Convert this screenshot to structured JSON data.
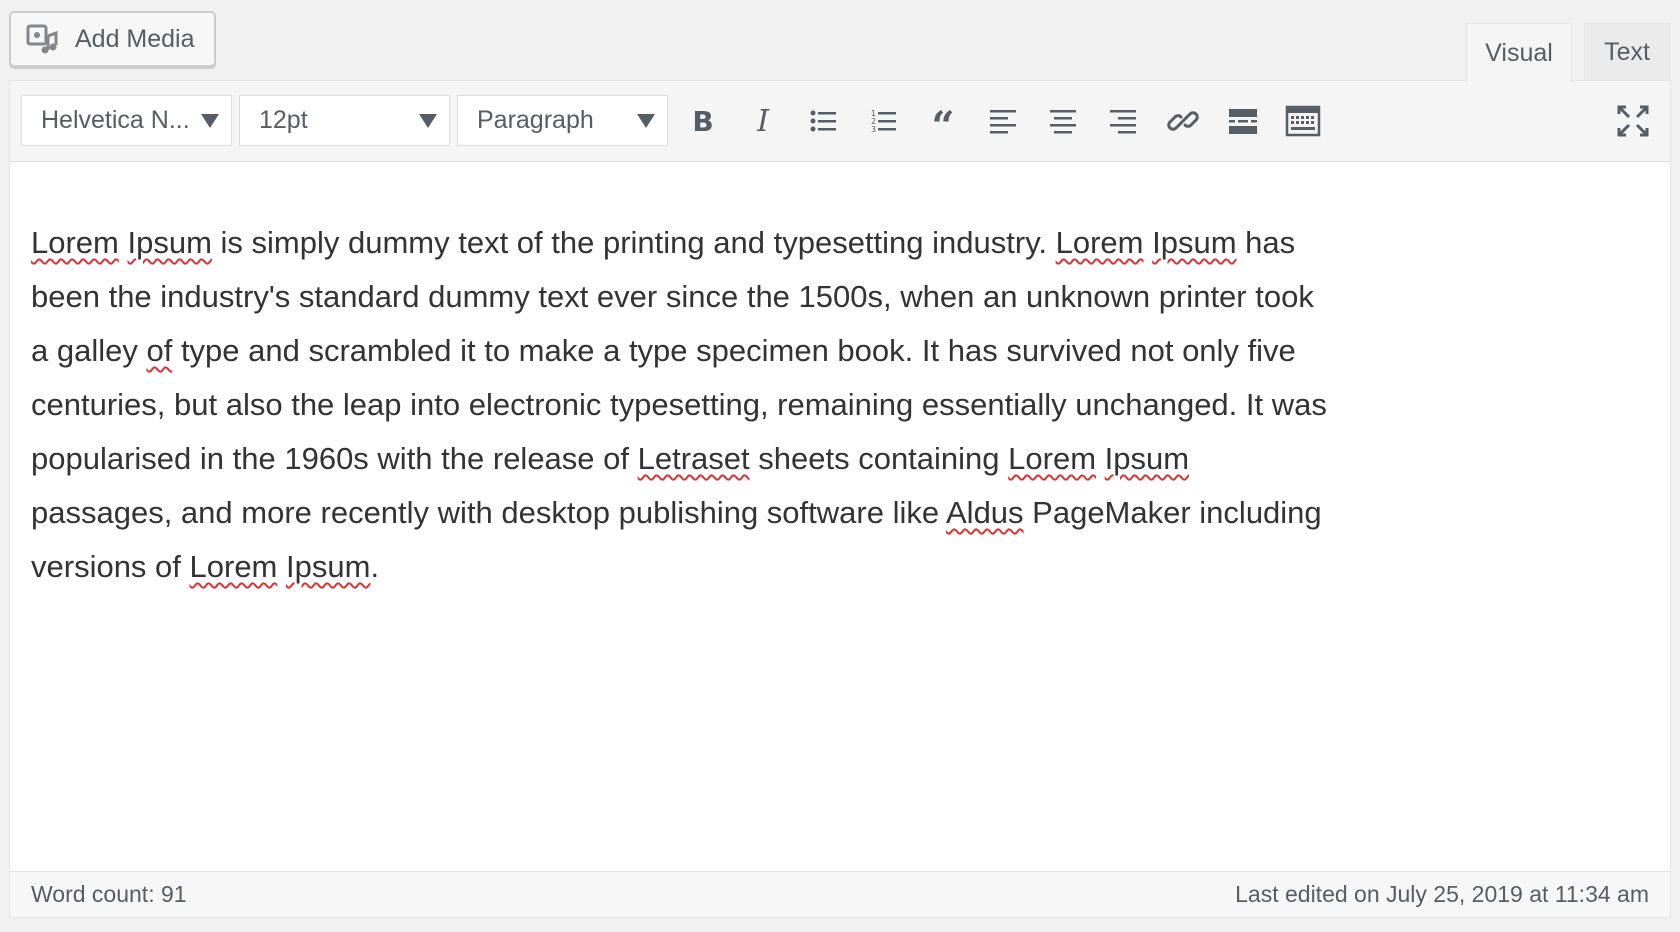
{
  "add_media": {
    "label": "Add Media",
    "icon": "media-icon"
  },
  "tabs": {
    "visual": "Visual",
    "text": "Text",
    "active": "visual"
  },
  "toolbar": {
    "font_family": "Helvetica N...",
    "font_size": "12pt",
    "format": "Paragraph",
    "buttons": [
      "bold-icon",
      "italic-icon",
      "bullet-list-icon",
      "numbered-list-icon",
      "blockquote-icon",
      "align-left-icon",
      "align-center-icon",
      "align-right-icon",
      "link-icon",
      "read-more-icon",
      "toolbar-toggle-icon",
      "fullscreen-icon"
    ]
  },
  "content": {
    "segments": [
      {
        "text": "Lorem",
        "spell": true
      },
      {
        "text": " "
      },
      {
        "text": "Ipsum",
        "spell": true
      },
      {
        "text": " is simply dummy text of the printing and typesetting industry. "
      },
      {
        "text": "Lorem",
        "spell": true
      },
      {
        "text": " "
      },
      {
        "text": "Ipsum",
        "spell": true
      },
      {
        "text": " has been the industry's standard dummy text ever since the 1500s, when an unknown printer took a galley "
      },
      {
        "text": "of",
        "spell": true
      },
      {
        "text": " type and scrambled it to make a type specimen book. It has survived not only five centuries, but also the leap into electronic typesetting, remaining essentially unchanged. It was popularised in the 1960s with the release of "
      },
      {
        "text": "Letraset",
        "spell": true
      },
      {
        "text": " sheets containing "
      },
      {
        "text": "Lorem",
        "spell": true
      },
      {
        "text": " "
      },
      {
        "text": "Ipsum",
        "spell": true
      },
      {
        "text": " passages, and more recently with desktop publishing software like "
      },
      {
        "text": "Aldus",
        "spell": true
      },
      {
        "text": " PageMaker including versions of "
      },
      {
        "text": "Lorem",
        "spell": true
      },
      {
        "text": " "
      },
      {
        "text": "Ipsum",
        "spell": true
      },
      {
        "text": "."
      }
    ]
  },
  "status": {
    "word_count": "Word count: 91",
    "last_edited": "Last edited on July 25, 2019 at 11:34 am"
  }
}
